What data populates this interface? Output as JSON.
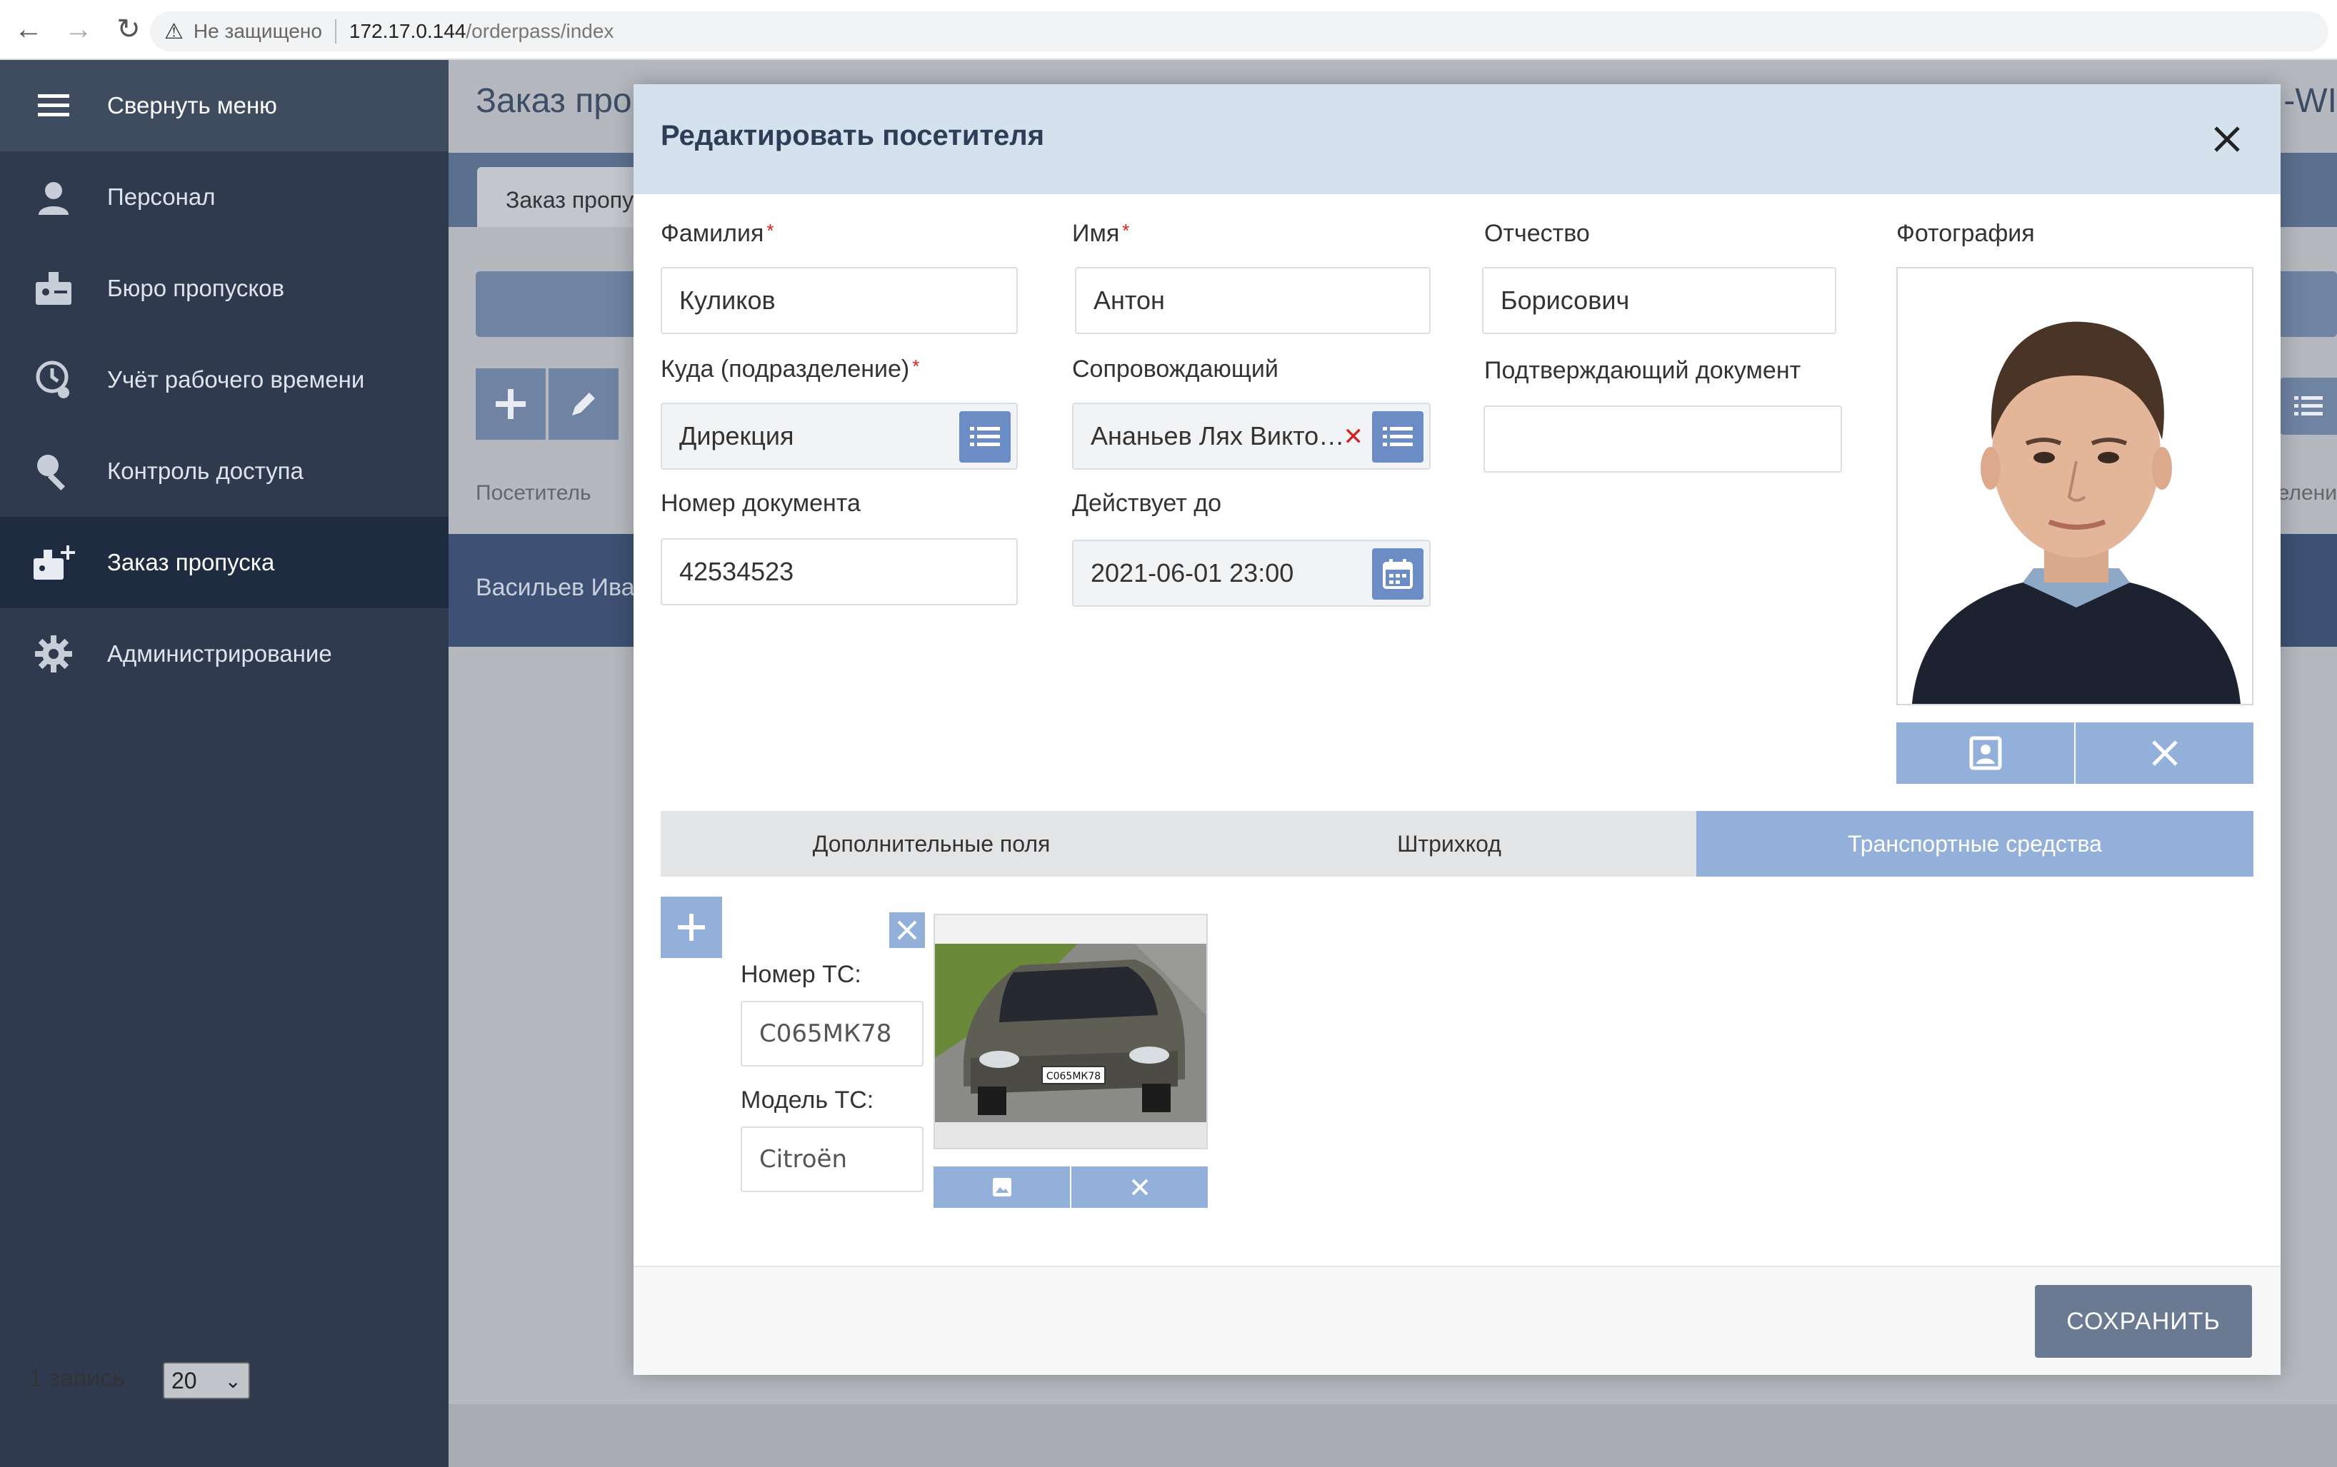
{
  "browser": {
    "back": "←",
    "forward": "→",
    "reload": "↻",
    "insecure_label": "Не защищено",
    "url_host": "172.17.0.144",
    "url_path": "/orderpass/index"
  },
  "sidebar": {
    "collapse_label": "Свернуть меню",
    "items": [
      {
        "label": "Персонал",
        "icon": "person-icon"
      },
      {
        "label": "Бюро пропусков",
        "icon": "pass-bureau-icon"
      },
      {
        "label": "Учёт рабочего времени",
        "icon": "time-tracking-icon"
      },
      {
        "label": "Контроль доступа",
        "icon": "key-icon"
      },
      {
        "label": "Заказ пропуска",
        "icon": "order-pass-icon",
        "active": true
      },
      {
        "label": "Администрирование",
        "icon": "gear-icon"
      }
    ]
  },
  "background": {
    "title": "Заказ проп",
    "title_right": "-WI",
    "tab_label": "Заказ пропу",
    "column_visitor": "Посетитель",
    "column_right": "елени",
    "row_name": "Васильев Ива",
    "record_count": "1 запись",
    "page_size": "20"
  },
  "modal": {
    "title": "Редактировать посетителя",
    "fields": {
      "last_name": {
        "label": "Фамилия",
        "value": "Куликов"
      },
      "first_name": {
        "label": "Имя",
        "value": "Антон"
      },
      "patronymic": {
        "label": "Отчество",
        "value": "Борисович"
      },
      "department": {
        "label": "Куда (подразделение)",
        "value": "Дирекция"
      },
      "escort": {
        "label": "Сопровождающий",
        "value": "Ананьев Лях Викто…"
      },
      "confirm_doc": {
        "label": "Подтверждающий документ",
        "value": ""
      },
      "doc_number": {
        "label": "Номер документа",
        "value": "42534523"
      },
      "valid_until": {
        "label": "Действует до",
        "value": "2021-06-01 23:00"
      }
    },
    "required_mark": "*",
    "photo_label": "Фотография",
    "tabs": [
      {
        "label": "Дополнительные поля"
      },
      {
        "label": "Штрихкод"
      },
      {
        "label": "Транспортные средства",
        "active": true
      }
    ],
    "vehicle": {
      "number_label": "Номер ТС:",
      "number_value": "С065МК78",
      "model_label": "Модель ТС:",
      "model_value": "Citroën",
      "plate_text": "С065МК78"
    },
    "save_label": "СОХРАНИТЬ"
  },
  "colors": {
    "sidebar_bg": "#2f3a4e",
    "sidebar_active": "#1f2b40",
    "modal_header": "#d6e1ee",
    "accent_button": "#93b0da",
    "list_button": "#6b8cc4",
    "save_button": "#6a7a92"
  }
}
